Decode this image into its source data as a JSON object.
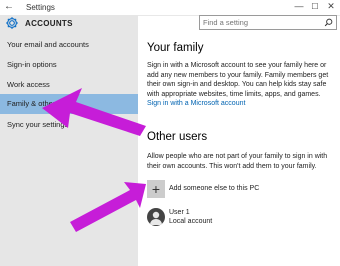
{
  "window": {
    "title": "Settings",
    "back_glyph": "←",
    "controls": {
      "minimize": "—",
      "maximize": "☐",
      "close": "✕"
    }
  },
  "search": {
    "placeholder": "Find a setting"
  },
  "sidebar": {
    "header": "ACCOUNTS",
    "items": [
      {
        "label": "Your email and accounts"
      },
      {
        "label": "Sign-in options"
      },
      {
        "label": "Work access"
      },
      {
        "label": "Family & other users",
        "selected": true
      },
      {
        "label": "Sync your settings"
      }
    ]
  },
  "family": {
    "heading": "Your family",
    "text": "Sign in with a Microsoft account to see your family here or add any new members to your family. Family members get their own sign-in and desktop. You can help kids stay safe with appropriate websites, time limits, apps, and games.",
    "link": "Sign in with a Microsoft account"
  },
  "other_users": {
    "heading": "Other users",
    "text": "Allow people who are not part of your family to sign in with their own accounts. This won't add them to your family.",
    "add_label": "Add someone else to this PC",
    "add_glyph": "+",
    "user": {
      "name": "User 1",
      "type": "Local account"
    }
  },
  "colors": {
    "sidebar_bg": "#e6e6e6",
    "selected_bg": "#8cb9e1",
    "link": "#0063b1",
    "annotation_arrow": "#c61dd8"
  },
  "icons": [
    "gear-icon",
    "search-icon",
    "plus-icon",
    "user-avatar-icon",
    "annotation-arrow"
  ]
}
